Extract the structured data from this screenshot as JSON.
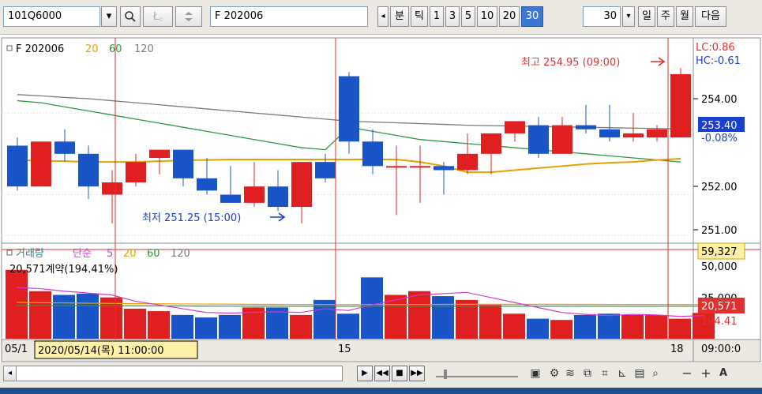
{
  "toolbar": {
    "code": "101Q6000",
    "dropdown_icon": "chevron-down-icon",
    "search_icon": "search-icon",
    "disabled_btn": "Ł꜀",
    "stepper_icon": "updown-stepper-icon",
    "instrument": "F 202006",
    "scroll_left": "◂",
    "period_buttons": [
      "분",
      "틱",
      "1",
      "3",
      "5",
      "10",
      "20",
      "30"
    ],
    "active_period": "30",
    "interval_value": "30",
    "interval_dropdown": "▾",
    "range_buttons": [
      "일",
      "주",
      "월",
      "다음"
    ]
  },
  "legend_price": {
    "name": "F 202006",
    "ma20": "20",
    "ma60": "60",
    "ma120": "120",
    "colors": {
      "ma20": "#e8a000",
      "ma60": "#2a9a3a",
      "ma120": "#7a7a7a"
    }
  },
  "legend_volume": {
    "name": "거래량",
    "ma_label": "단순",
    "ma5": "5",
    "ma20": "20",
    "ma60": "60",
    "ma120": "120",
    "summary": "20,571계약(194.41%)"
  },
  "annotations": {
    "high": "최고 254.95 (09:00)",
    "low": "최저 251.25 (15:00)"
  },
  "right_axis": {
    "lc": "LC:0.86",
    "hc": "HC:-0.61",
    "ticks": [
      "254.00",
      "252.00",
      "251.00"
    ],
    "current_price": "253.40",
    "current_change": "-0.08%",
    "volume_box": "59,327",
    "volume_tick": "50,000",
    "volume_tick2": "25,000",
    "current_volume": "20,571",
    "current_pct": "194.41"
  },
  "x_axis": {
    "labels": [
      "05/1",
      "15",
      "18"
    ],
    "cursor_label": "2020/05/14(목) 11:00:00",
    "time_readout": "09:00:0"
  },
  "chart_data": {
    "type": "candlestick",
    "ylim": [
      250.85,
      255.8
    ],
    "volume_ylim": [
      0,
      70000
    ],
    "candles": [
      {
        "o": 253.2,
        "h": 253.4,
        "l": 252.1,
        "c": 252.2
      },
      {
        "o": 252.2,
        "h": 253.3,
        "l": 252.2,
        "c": 253.3
      },
      {
        "o": 253.3,
        "h": 253.6,
        "l": 252.8,
        "c": 253.0
      },
      {
        "o": 253.0,
        "h": 253.2,
        "l": 251.9,
        "c": 252.2
      },
      {
        "o": 252.0,
        "h": 252.6,
        "l": 251.3,
        "c": 252.3
      },
      {
        "o": 252.3,
        "h": 253.0,
        "l": 252.2,
        "c": 252.8
      },
      {
        "o": 252.9,
        "h": 253.1,
        "l": 252.5,
        "c": 253.1
      },
      {
        "o": 253.1,
        "h": 253.1,
        "l": 252.2,
        "c": 252.4
      },
      {
        "o": 252.4,
        "h": 252.9,
        "l": 252.0,
        "c": 252.1
      },
      {
        "o": 252.0,
        "h": 252.7,
        "l": 251.9,
        "c": 251.8
      },
      {
        "o": 251.8,
        "h": 252.8,
        "l": 251.7,
        "c": 252.2
      },
      {
        "o": 252.2,
        "h": 252.6,
        "l": 251.6,
        "c": 251.7
      },
      {
        "o": 251.7,
        "h": 252.8,
        "l": 251.3,
        "c": 252.8
      },
      {
        "o": 252.8,
        "h": 253.0,
        "l": 252.3,
        "c": 252.4
      },
      {
        "o": 254.9,
        "h": 255.0,
        "l": 253.0,
        "c": 253.3
      },
      {
        "o": 253.3,
        "h": 253.6,
        "l": 252.5,
        "c": 252.7
      },
      {
        "o": 252.7,
        "h": 253.2,
        "l": 251.5,
        "c": 252.7
      },
      {
        "o": 252.7,
        "h": 253.2,
        "l": 251.8,
        "c": 252.7
      },
      {
        "o": 252.7,
        "h": 252.8,
        "l": 252.0,
        "c": 252.6
      },
      {
        "o": 252.6,
        "h": 253.5,
        "l": 252.5,
        "c": 253.0
      },
      {
        "o": 253.0,
        "h": 253.5,
        "l": 252.5,
        "c": 253.5
      },
      {
        "o": 253.5,
        "h": 253.8,
        "l": 253.3,
        "c": 253.8
      },
      {
        "o": 253.7,
        "h": 253.9,
        "l": 252.9,
        "c": 253.0
      },
      {
        "o": 253.0,
        "h": 253.9,
        "l": 253.0,
        "c": 253.7
      },
      {
        "o": 253.7,
        "h": 254.2,
        "l": 253.5,
        "c": 253.6
      },
      {
        "o": 253.6,
        "h": 254.2,
        "l": 253.3,
        "c": 253.4
      },
      {
        "o": 253.4,
        "h": 254.0,
        "l": 253.3,
        "c": 253.5
      },
      {
        "o": 253.4,
        "h": 253.7,
        "l": 253.3,
        "c": 253.6
      },
      {
        "o": 253.4,
        "h": 255.1,
        "l": 253.4,
        "c": 254.95
      }
    ],
    "volume": [
      55000,
      38000,
      35000,
      36000,
      33000,
      24000,
      22000,
      19000,
      17000,
      19000,
      25000,
      25000,
      19000,
      31000,
      20000,
      49000,
      35000,
      38000,
      34000,
      31000,
      27000,
      20000,
      16000,
      15000,
      19000,
      20000,
      19000,
      19000,
      16000,
      20571
    ],
    "ma20": [
      252.85,
      252.83,
      252.82,
      252.8,
      252.8,
      252.8,
      252.82,
      252.84,
      252.85,
      252.86,
      252.86,
      252.86,
      252.86,
      252.86,
      252.86,
      252.86,
      252.86,
      252.8,
      252.7,
      252.55,
      252.55,
      252.6,
      252.65,
      252.7,
      252.75,
      252.78,
      252.8,
      252.85,
      252.88
    ],
    "ma60": [
      254.3,
      254.25,
      254.15,
      254.05,
      253.95,
      253.85,
      253.75,
      253.65,
      253.55,
      253.45,
      253.35,
      253.25,
      253.15,
      253.1,
      253.65,
      253.55,
      253.45,
      253.35,
      253.3,
      253.25,
      253.2,
      253.15,
      253.1,
      253.05,
      253.0,
      252.95,
      252.9,
      252.85,
      252.8
    ],
    "ma120": [
      254.45,
      254.42,
      254.38,
      254.35,
      254.3,
      254.25,
      254.2,
      254.15,
      254.1,
      254.05,
      254.0,
      253.95,
      253.9,
      253.85,
      253.8,
      253.78,
      253.76,
      253.74,
      253.72,
      253.7,
      253.69,
      253.68,
      253.67,
      253.66,
      253.65,
      253.64,
      253.63,
      253.62,
      253.61
    ],
    "vol_ma5": [
      41000,
      40000,
      38000,
      36500,
      35000,
      30000,
      27000,
      24000,
      21000,
      20500,
      21000,
      21500,
      21000,
      24000,
      22500,
      27000,
      31000,
      35000,
      36000,
      37000,
      33000,
      29000,
      25000,
      21000,
      19500,
      18500,
      19500,
      19000,
      17800,
      18500
    ],
    "vol_ma20": [
      29000,
      28800,
      28600,
      28400,
      28200,
      28000,
      27900,
      27800,
      27700,
      27600,
      27500,
      27450,
      27400,
      27350,
      27300,
      27300,
      27350,
      27400,
      27450,
      27500,
      27500,
      27500,
      27500,
      27500,
      27450,
      27400,
      27400,
      27400,
      27350,
      27300
    ],
    "vol_ma60": [
      26500,
      26450,
      26400,
      26350,
      26300,
      26250,
      26200,
      26150,
      26100,
      26050,
      26000,
      26000,
      26000,
      26000,
      26000,
      26000,
      26000,
      26000,
      26000,
      26000,
      26000,
      26000,
      26000,
      26000,
      26000,
      26000,
      26000,
      26000,
      26000,
      26000
    ]
  }
}
